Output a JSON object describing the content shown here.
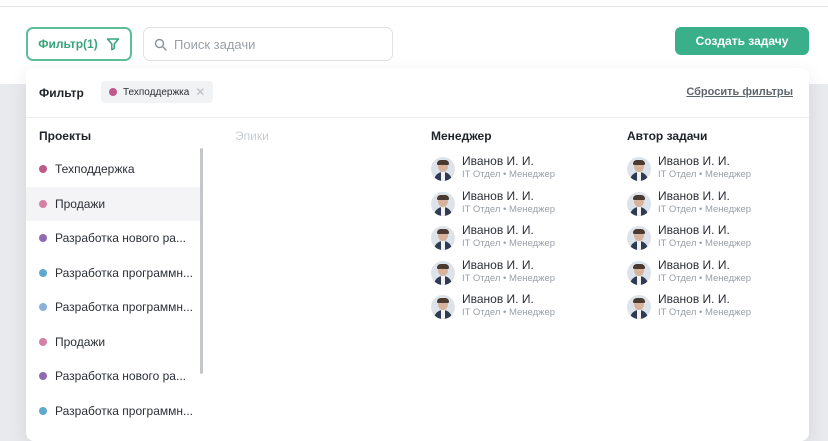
{
  "toolbar": {
    "filter_label": "Фильтр(1)",
    "search_placeholder": "Поиск задачи",
    "create_label": "Создать задачу"
  },
  "filter_panel": {
    "title": "Фильтр",
    "active_chip": {
      "label": "Техподдержка",
      "color": "#c05a8a"
    },
    "reset_label": "Сбросить фильтры"
  },
  "columns": {
    "projects": "Проекты",
    "epics": "Эпики",
    "manager": "Менеджер",
    "author": "Автор задачи"
  },
  "projects": [
    {
      "label": "Техподдержка",
      "color": "#c05a8a",
      "selected": false
    },
    {
      "label": "Продажи",
      "color": "#d47fa6",
      "selected": true
    },
    {
      "label": "Разработка нового ра...",
      "color": "#8f6ab0",
      "selected": false
    },
    {
      "label": "Разработка программн...",
      "color": "#5fa8cf",
      "selected": false
    },
    {
      "label": "Разработка программн...",
      "color": "#8ab3d9",
      "selected": false
    },
    {
      "label": "Продажи",
      "color": "#d47fa6",
      "selected": false
    },
    {
      "label": "Разработка нового ра...",
      "color": "#8f6ab0",
      "selected": false
    },
    {
      "label": "Разработка программн...",
      "color": "#5fa8cf",
      "selected": false
    }
  ],
  "managers": [
    {
      "name": "Иванов И. И.",
      "role": "IT Отдел • Менеджер"
    },
    {
      "name": "Иванов И. И.",
      "role": "IT Отдел • Менеджер"
    },
    {
      "name": "Иванов И. И.",
      "role": "IT Отдел • Менеджер"
    },
    {
      "name": "Иванов И. И.",
      "role": "IT Отдел • Менеджер"
    },
    {
      "name": "Иванов И. И.",
      "role": "IT Отдел • Менеджер"
    }
  ],
  "authors": [
    {
      "name": "Иванов И. И.",
      "role": "IT Отдел • Менеджер"
    },
    {
      "name": "Иванов И. И.",
      "role": "IT Отдел • Менеджер"
    },
    {
      "name": "Иванов И. И.",
      "role": "IT Отдел • Менеджер"
    },
    {
      "name": "Иванов И. И.",
      "role": "IT Отдел • Менеджер"
    },
    {
      "name": "Иванов И. И.",
      "role": "IT Отдел • Менеджер"
    }
  ],
  "colors": {
    "accent": "#39b089",
    "accent_outline": "#5dbf9a"
  }
}
